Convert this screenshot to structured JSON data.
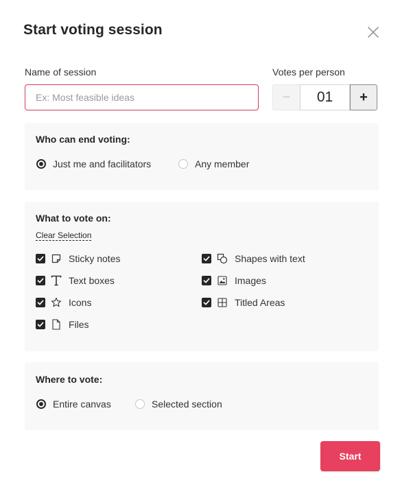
{
  "dialog": {
    "title": "Start voting session",
    "close_icon": "close-icon"
  },
  "session_name": {
    "label": "Name of session",
    "value": "",
    "placeholder": "Ex: Most feasible ideas"
  },
  "votes": {
    "label": "Votes per person",
    "minus": "−",
    "value": "01",
    "plus": "+"
  },
  "who_can_end": {
    "title": "Who can end voting:",
    "options": [
      {
        "label": "Just me and facilitators",
        "selected": true
      },
      {
        "label": "Any member",
        "selected": false
      }
    ]
  },
  "what_to_vote": {
    "title": "What to vote on:",
    "clear_label": "Clear Selection",
    "items": [
      {
        "label": "Sticky notes",
        "icon": "sticky-note-icon",
        "checked": true
      },
      {
        "label": "Shapes with text",
        "icon": "shapes-icon",
        "checked": true
      },
      {
        "label": "Text boxes",
        "icon": "text-icon",
        "checked": true
      },
      {
        "label": "Images",
        "icon": "image-icon",
        "checked": true
      },
      {
        "label": "Icons",
        "icon": "star-icon",
        "checked": true
      },
      {
        "label": "Titled Areas",
        "icon": "grid-icon",
        "checked": true
      },
      {
        "label": "Files",
        "icon": "file-icon",
        "checked": true
      }
    ]
  },
  "where_to_vote": {
    "title": "Where to vote:",
    "options": [
      {
        "label": "Entire canvas",
        "selected": true
      },
      {
        "label": "Selected section",
        "selected": false
      }
    ]
  },
  "start_label": "Start",
  "colors": {
    "accent": "#e8405f",
    "input_border": "#d63a5a",
    "panel_bg": "#f8f8f8",
    "text": "#262626"
  }
}
